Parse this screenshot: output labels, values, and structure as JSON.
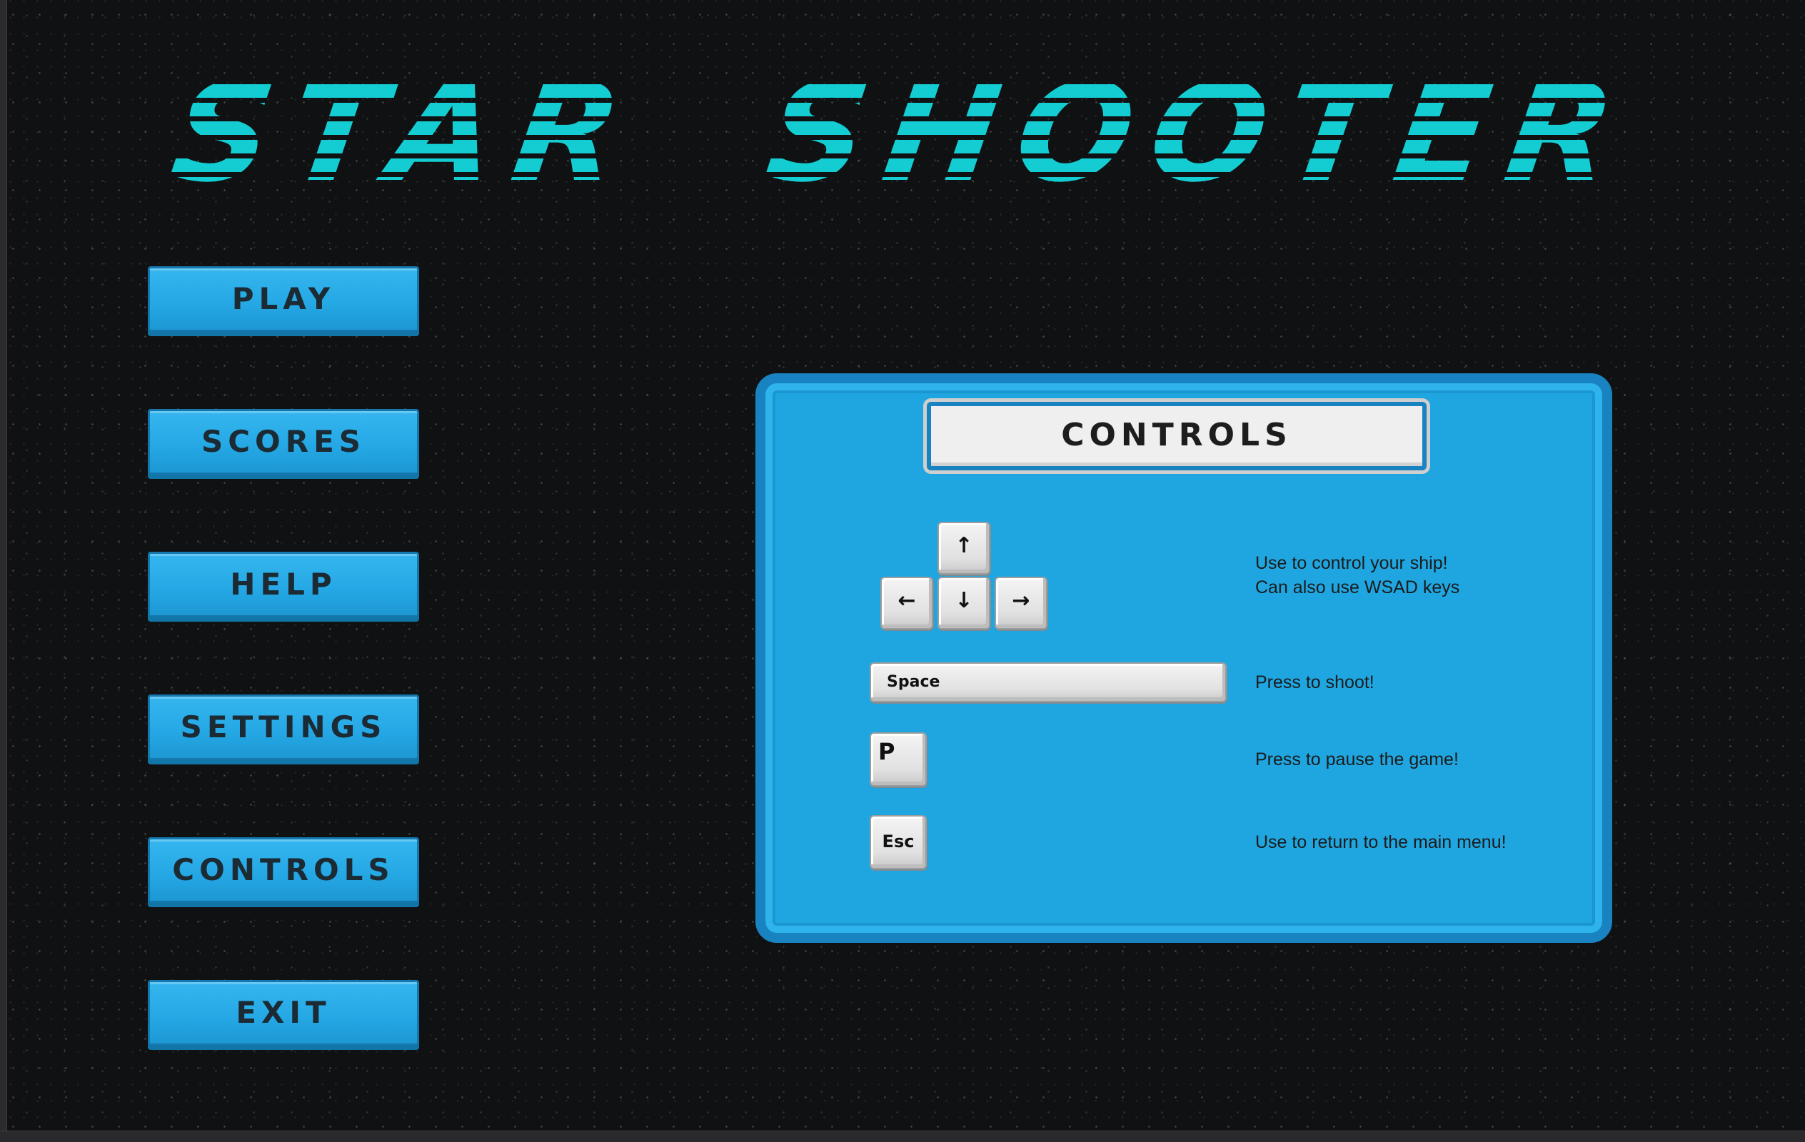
{
  "title": "STAR  SHOOTER",
  "menu": {
    "play": "PLAY",
    "scores": "SCORES",
    "help": "HELP",
    "settings": "SETTINGS",
    "controls": "CONTROLS",
    "exit": "EXIT"
  },
  "controls_panel": {
    "title": "CONTROLS",
    "keys": {
      "up": "↑",
      "left": "←",
      "down": "↓",
      "right": "→",
      "space": "Space",
      "p": "P",
      "esc": "Esc"
    },
    "descriptions": {
      "arrows_line1": "Use to control your ship!",
      "arrows_line2": "Can also use WSAD keys",
      "space": "Press to shoot!",
      "pause": "Press to pause the game!",
      "esc": "Use to return to the main menu!"
    }
  },
  "colors": {
    "title": "#13cdd2",
    "button": "#24a7e4",
    "panel": "#1fa6e0",
    "panel_border": "#1883c0",
    "background": "#101112"
  }
}
